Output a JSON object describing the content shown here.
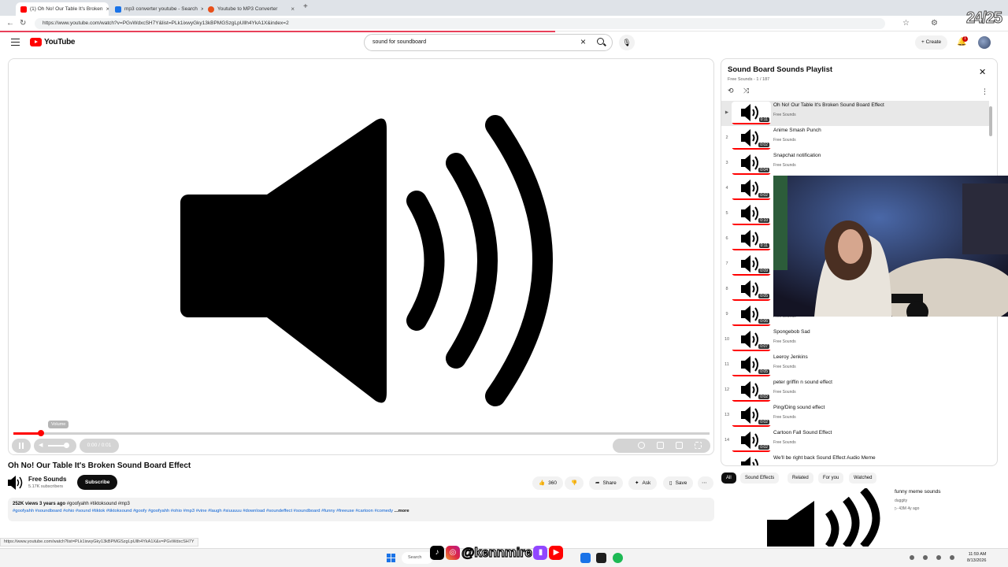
{
  "browser": {
    "tabs": [
      {
        "label": "(1) Oh No! Our Table It's Broken",
        "active": true
      },
      {
        "label": "mp3 converter youtube - Search",
        "active": false
      },
      {
        "label": "Youtube to MP3 Converter",
        "active": false
      }
    ],
    "url": "https://www.youtube.com/watch?v=PGvWdxcSH7Y&list=PLk1ixwyGky13kBPMGSzgLpUllh4YkA1X&index=2",
    "overlay_counter": "24/25"
  },
  "header": {
    "logo": "YouTube",
    "search_query": "sound for soundboard",
    "create_label": "Create",
    "notification_count": "1"
  },
  "player": {
    "volume_tooltip": "Volume",
    "time": "0:00 / 0:01",
    "progress": 0.04,
    "volume_level": 0.8
  },
  "video": {
    "title": "Oh No! Our Table It's Broken Sound Board Effect",
    "channel": "Free Sounds",
    "subscribers": "5.17K subscribers",
    "subscribe_label": "Subscribe",
    "likes": "360",
    "share_label": "Share",
    "ask_label": "Ask",
    "save_label": "Save",
    "views_age": "252K views  3 years ago",
    "top_tags": "#goofyahh #tiktoksound #mp3",
    "tags": "#goofyahh #soundboard #ohio #sound #tiktok #tiktoksound #goofy #goofyahh #ohio #mp3 #vine #laugh #siuuuuu #download #soundeffect #soundboard #funny #freeuse  #cartoon #comedy",
    "more_label": "...more"
  },
  "status_url": "https://www.youtube.com/watch?list=PLk1ixwyGky13kBPMGSzgLpUllh4YkA1X&v=PGvWdxcSH7Y",
  "playlist": {
    "title": "Sound Board Sounds Playlist",
    "subtitle": "Free Sounds - 1 / 187",
    "items": [
      {
        "index": "▶",
        "title": "Oh No! Our Table It's Broken Sound Board Effect",
        "channel": "Free Sounds",
        "duration": "0:11",
        "current": true
      },
      {
        "index": "2",
        "title": "Anime Smash Punch",
        "channel": "Free Sounds",
        "duration": "0:02"
      },
      {
        "index": "3",
        "title": "Snapchat notification",
        "channel": "Free Sounds",
        "duration": "0:04"
      },
      {
        "index": "4",
        "title": "",
        "channel": "",
        "duration": "0:02"
      },
      {
        "index": "5",
        "title": "",
        "channel": "",
        "duration": "0:10"
      },
      {
        "index": "6",
        "title": "",
        "channel": "",
        "duration": "0:11"
      },
      {
        "index": "7",
        "title": "",
        "channel": "",
        "duration": "0:09"
      },
      {
        "index": "8",
        "title": "",
        "channel": "",
        "duration": "0:05"
      },
      {
        "index": "9",
        "title": "",
        "channel": "Free Sounds",
        "duration": "0:06"
      },
      {
        "index": "10",
        "title": "Spongebob Sad",
        "channel": "Free Sounds",
        "duration": "0:07"
      },
      {
        "index": "11",
        "title": "Leeroy Jenkins",
        "channel": "Free Sounds",
        "duration": "0:05"
      },
      {
        "index": "12",
        "title": "peter griffin n sound effect",
        "channel": "Free Sounds",
        "duration": "0:02"
      },
      {
        "index": "13",
        "title": "Ping/Ding sound effect",
        "channel": "Free Sounds",
        "duration": "0:02"
      },
      {
        "index": "14",
        "title": "Cartoon Fall Sound Effect",
        "channel": "Free Sounds",
        "duration": "0:02"
      },
      {
        "index": "",
        "title": "We'll be right back Sound Effect Audio Meme",
        "channel": "",
        "duration": ""
      }
    ]
  },
  "chips": [
    "All",
    "Sound Effects",
    "Related",
    "For you",
    "Watched"
  ],
  "recommended": {
    "title": "funny meme sounds",
    "channel": "duggity",
    "meta": "▷ 43M  4y ago"
  },
  "taskbar": {
    "search_label": "Search",
    "handle": "@kennmire",
    "time": "11:59 AM",
    "date": "8/13/2026"
  },
  "colors": {
    "accent": "#ff0000",
    "link": "#065fd4"
  }
}
